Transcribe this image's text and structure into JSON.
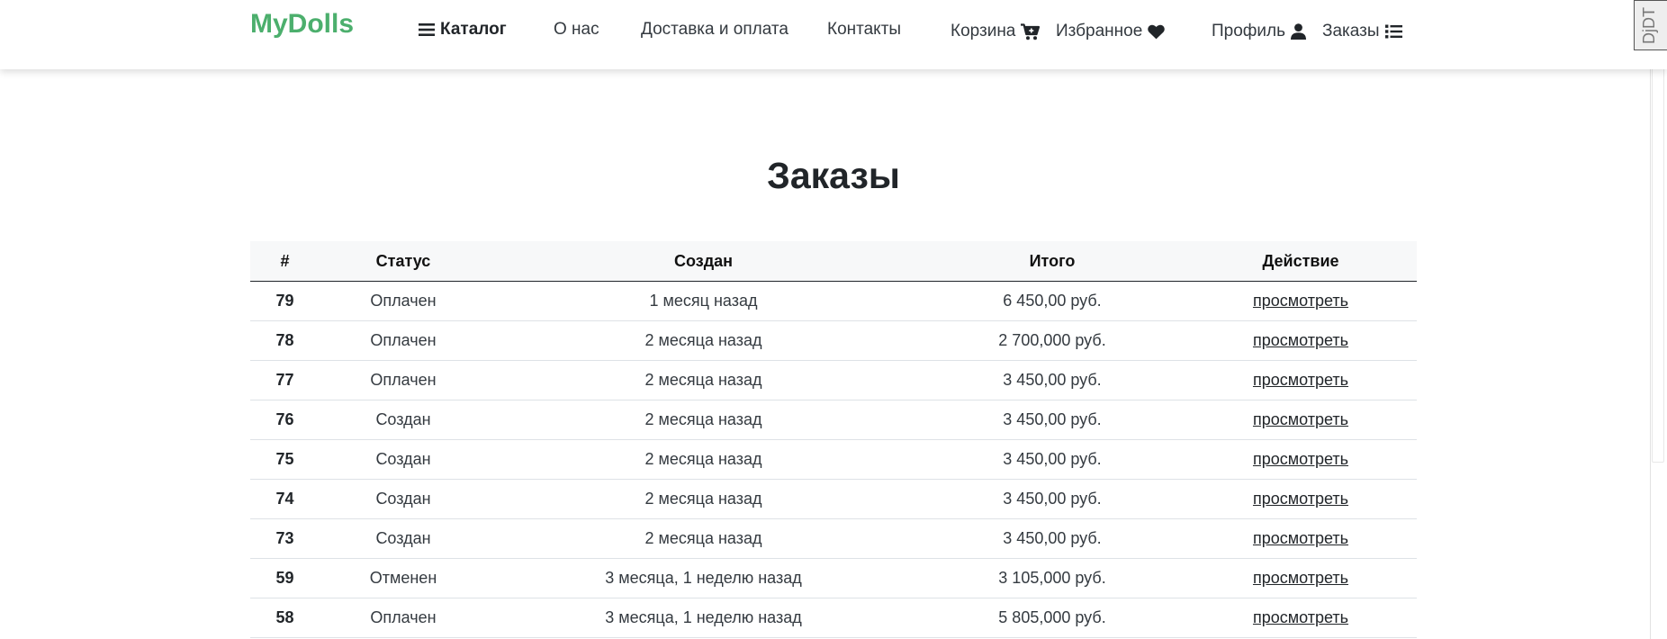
{
  "nav": {
    "brand": "MyDolls",
    "catalog": "Каталог",
    "about": "О нас",
    "delivery": "Доставка и оплата",
    "contacts": "Контакты",
    "cart": "Корзина",
    "favorites": "Избранное",
    "profile": "Профиль",
    "orders": "Заказы"
  },
  "debug_toolbar": {
    "label": "DjDT"
  },
  "page": {
    "title": "Заказы"
  },
  "table": {
    "headers": {
      "num": "#",
      "status": "Статус",
      "created": "Создан",
      "total": "Итого",
      "action": "Действие"
    },
    "rows": [
      {
        "num": "79",
        "status": "Оплачен",
        "created": "1 месяц назад",
        "total": "6 450,00 руб.",
        "action": "просмотреть"
      },
      {
        "num": "78",
        "status": "Оплачен",
        "created": "2 месяца назад",
        "total": "2 700,000 руб.",
        "action": "просмотреть"
      },
      {
        "num": "77",
        "status": "Оплачен",
        "created": "2 месяца назад",
        "total": "3 450,00 руб.",
        "action": "просмотреть"
      },
      {
        "num": "76",
        "status": "Создан",
        "created": "2 месяца назад",
        "total": "3 450,00 руб.",
        "action": "просмотреть"
      },
      {
        "num": "75",
        "status": "Создан",
        "created": "2 месяца назад",
        "total": "3 450,00 руб.",
        "action": "просмотреть"
      },
      {
        "num": "74",
        "status": "Создан",
        "created": "2 месяца назад",
        "total": "3 450,00 руб.",
        "action": "просмотреть"
      },
      {
        "num": "73",
        "status": "Создан",
        "created": "2 месяца назад",
        "total": "3 450,00 руб.",
        "action": "просмотреть"
      },
      {
        "num": "59",
        "status": "Отменен",
        "created": "3 месяца, 1 неделю назад",
        "total": "3 105,000 руб.",
        "action": "просмотреть"
      },
      {
        "num": "58",
        "status": "Оплачен",
        "created": "3 месяца, 1 неделю назад",
        "total": "5 805,000 руб.",
        "action": "просмотреть"
      }
    ]
  },
  "colors": {
    "brand": "#4caf6d",
    "text": "#212529",
    "header_bg": "#f7f8f9"
  },
  "icons": {
    "catalog": "bars-icon",
    "cart": "cart-icon",
    "favorites": "heart-icon",
    "profile": "user-icon",
    "orders": "list-icon"
  }
}
